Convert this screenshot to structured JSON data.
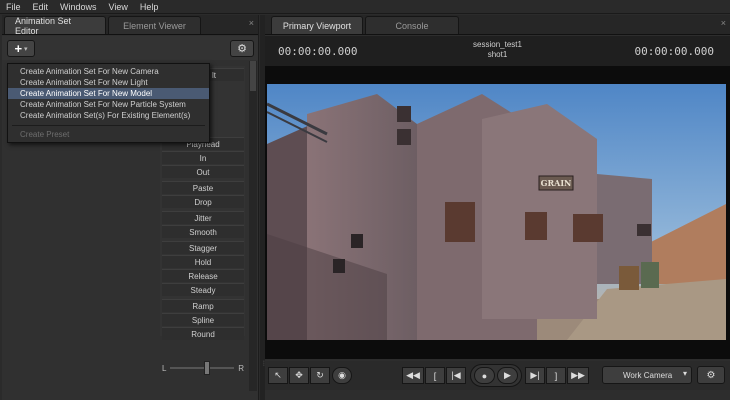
{
  "menu": [
    "File",
    "Edit",
    "Windows",
    "View",
    "Help"
  ],
  "left_panel": {
    "tabs": [
      "Animation Set Editor",
      "Element Viewer"
    ],
    "close_symbol": "×",
    "add_button_label": "+",
    "add_button_arrow": "▾",
    "gear_symbol": "⚙"
  },
  "dropdown": {
    "items": [
      "Create Animation Set For New Camera",
      "Create Animation Set For New Light",
      "Create Animation Set For New Model",
      "Create Animation Set For New Particle System",
      "Create Animation Set(s) For Existing Element(s)"
    ],
    "highlighted_index": 2,
    "disabled_item": "Create Preset"
  },
  "commands": {
    "group1": [
      "Playhead",
      "In",
      "Out"
    ],
    "group2": [
      "Paste",
      "Drop"
    ],
    "group3": [
      "Jitter",
      "Smooth"
    ],
    "group4": [
      "Stagger",
      "Hold",
      "Release",
      "Steady"
    ],
    "group5": [
      "Ramp",
      "Spline",
      "Round"
    ],
    "partial_top": "lt"
  },
  "slider": {
    "left_label": "L",
    "right_label": "R",
    "value": 0.5
  },
  "right_panel": {
    "tabs": [
      "Primary Viewport",
      "Console"
    ],
    "close_symbol": "×",
    "timecode_left": "00:00:00.000",
    "timecode_right": "00:00:00.000",
    "session_name": "session_test1",
    "shot_name": "shot1"
  },
  "viewport": {
    "sign_text": "GRAIN"
  },
  "toolbar": {
    "camera_label": "Work Camera",
    "camera_arrow": "▾",
    "gear_symbol": "⚙"
  },
  "colors": {
    "highlight": "#4a5a73",
    "sky": "#5f8fc4",
    "building": "#7a6a6f"
  }
}
